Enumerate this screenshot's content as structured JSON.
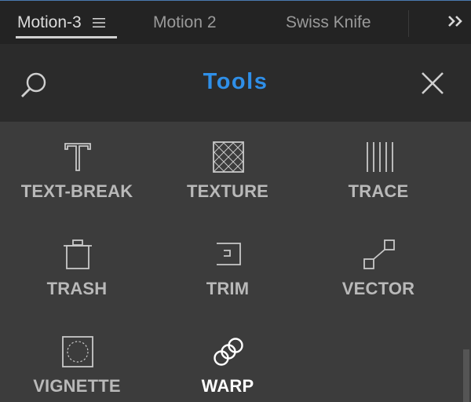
{
  "tabs": [
    {
      "label": "Motion-3",
      "active": true
    },
    {
      "label": "Motion 2",
      "active": false
    },
    {
      "label": "Swiss Knife",
      "active": false
    }
  ],
  "header": {
    "title": "Tools"
  },
  "tools": [
    {
      "label": "TEXT-BREAK",
      "icon": "text-break-icon"
    },
    {
      "label": "TEXTURE",
      "icon": "texture-icon"
    },
    {
      "label": "TRACE",
      "icon": "trace-icon"
    },
    {
      "label": "TRASH",
      "icon": "trash-icon"
    },
    {
      "label": "TRIM",
      "icon": "trim-icon"
    },
    {
      "label": "VECTOR",
      "icon": "vector-icon"
    },
    {
      "label": "VIGNETTE",
      "icon": "vignette-icon"
    },
    {
      "label": "WARP",
      "icon": "warp-icon",
      "selected": true
    }
  ],
  "colors": {
    "accent": "#2f8fe8",
    "tab_bar_bg": "#232323",
    "header_bg": "#2b2b2b",
    "grid_bg": "#3c3c3c",
    "tool_label": "#b9b9b9",
    "tool_label_selected": "#ffffff"
  }
}
